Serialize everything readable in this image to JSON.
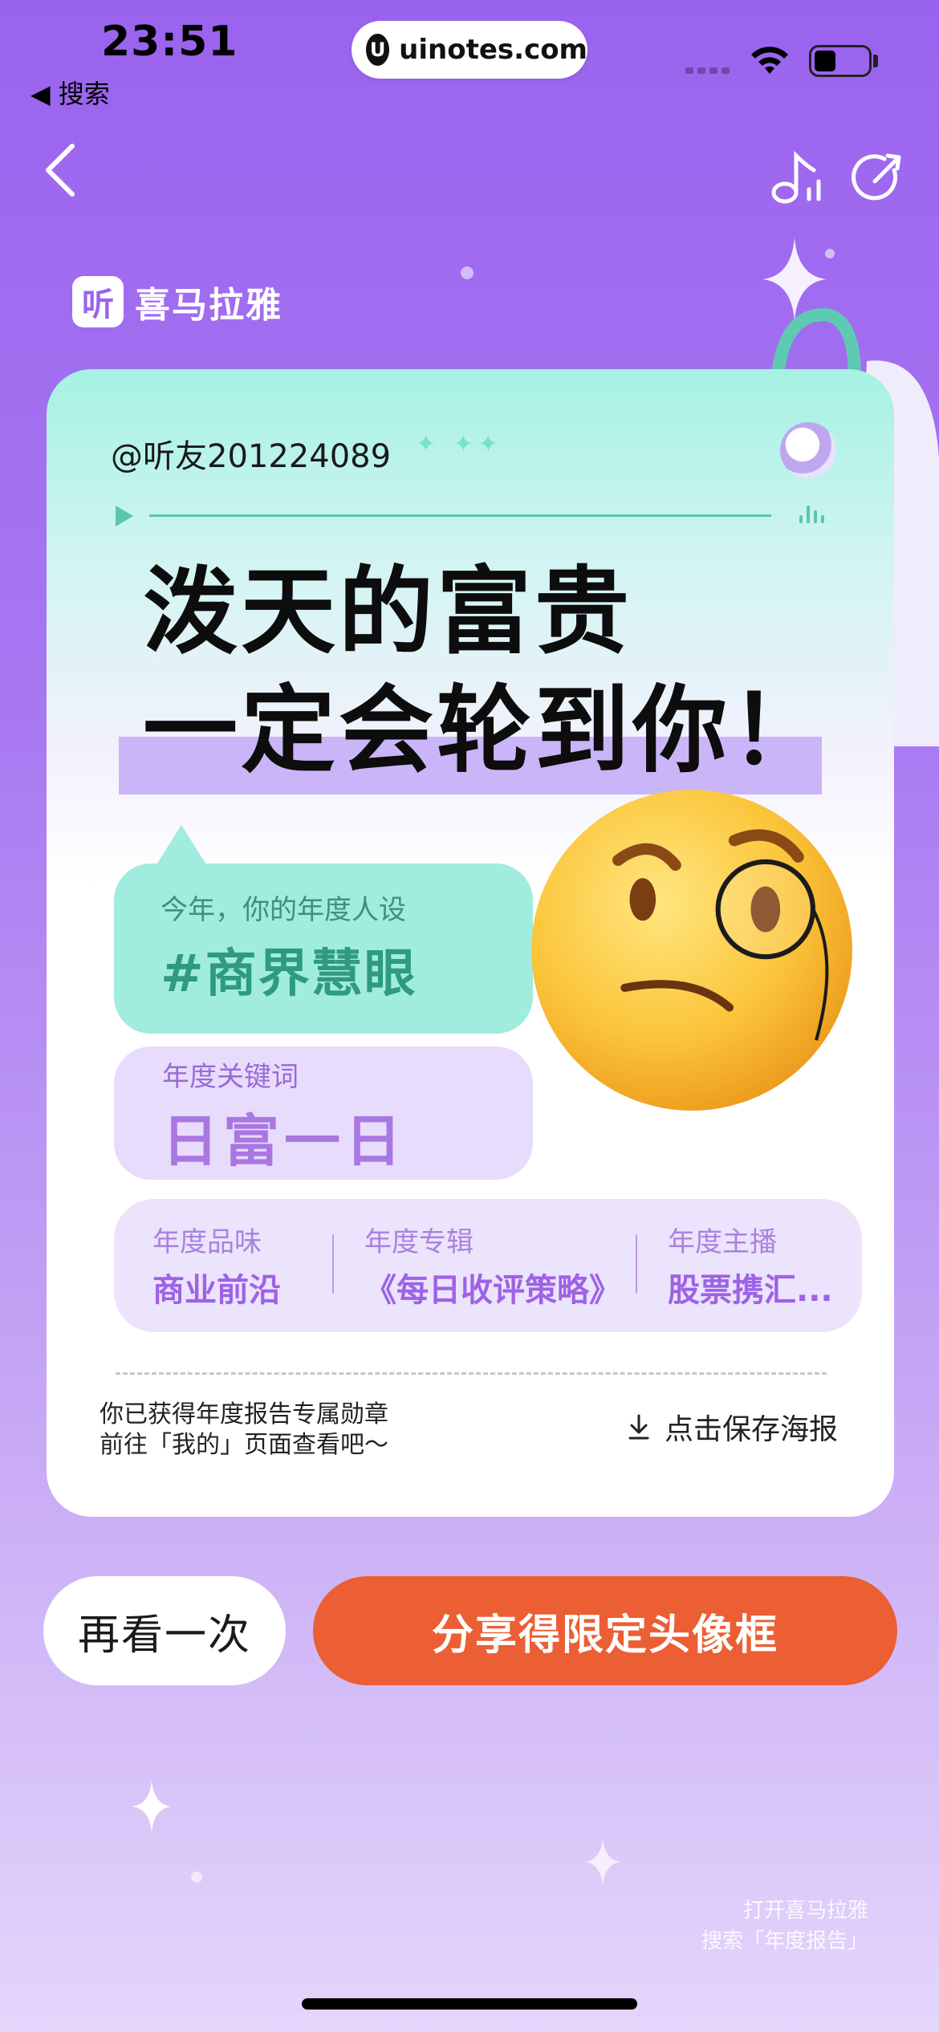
{
  "status_bar": {
    "time": "23:51",
    "back_label": "◀ 搜索",
    "url": "uinotes.com",
    "url_logo": "U"
  },
  "nav": {
    "back_icon": "chevron-left-icon",
    "music_icon": "music-note-icon",
    "share_icon": "share-icon"
  },
  "brand": {
    "icon_text": "听",
    "name": "喜马拉雅"
  },
  "card": {
    "user_handle": "@听友201224089",
    "headline_line1": "泼天的富贵",
    "headline_line2": "一定会轮到你！",
    "persona_label": "今年，你的年度人设",
    "persona_value": "#商界慧眼",
    "keyword_label": "年度关键词",
    "keyword_value": "日富一日",
    "stats": [
      {
        "label": "年度品味",
        "value": "商业前沿"
      },
      {
        "label": "年度专辑",
        "value": "《每日收评策略》"
      },
      {
        "label": "年度主播",
        "value": "股票携汇..."
      }
    ],
    "notice_line1": "你已获得年度报告专属勋章",
    "notice_line2": "前往「我的」页面查看吧～",
    "save_label": "点击保存海报"
  },
  "actions": {
    "again_label": "再看一次",
    "share_label": "分享得限定头像框"
  },
  "footer": {
    "line1": "打开喜马拉雅",
    "line2": "搜索「年度报告」"
  },
  "colors": {
    "background_top": "#9a63ee",
    "accent_orange": "#ec5e33",
    "mint": "#a0ecde",
    "lavender": "#e7dcfb"
  }
}
